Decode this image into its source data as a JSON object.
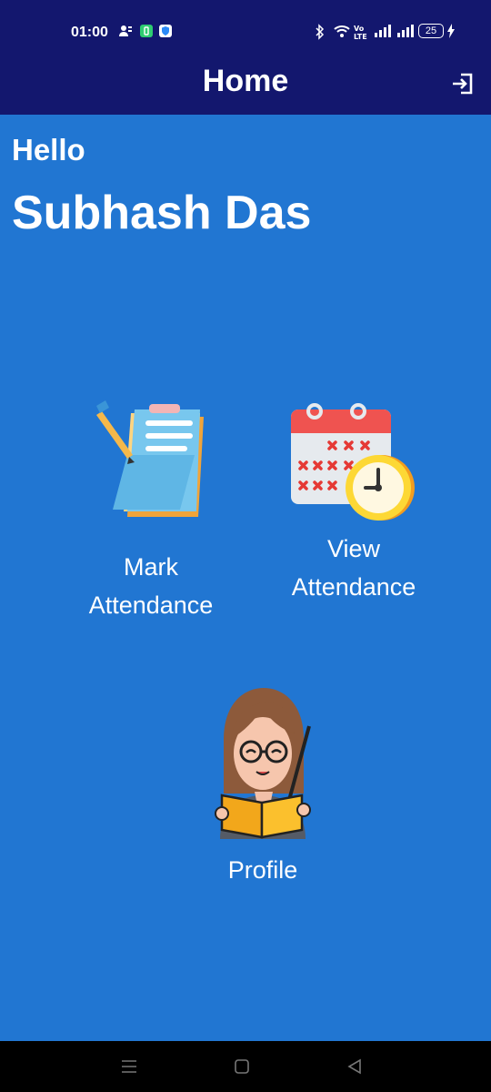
{
  "status_bar": {
    "time": "01:00",
    "icons": [
      "contacts-icon",
      "battery-saver-icon",
      "shield-icon",
      "bluetooth-icon",
      "wifi-icon",
      "volte-icon",
      "signal-icon",
      "signal-2-icon",
      "battery-icon",
      "charging-icon"
    ],
    "volte_label": "VoLTE",
    "battery_level": "25"
  },
  "header": {
    "title": "Home",
    "logout_icon": "logout-icon"
  },
  "greeting": {
    "hello": "Hello",
    "name": "Subhash Das"
  },
  "menu": {
    "mark_attendance": {
      "line1": "Mark",
      "line2": "Attendance",
      "icon": "clipboard-icon"
    },
    "view_attendance": {
      "line1": "View",
      "line2": "Attendance",
      "icon": "calendar-clock-icon"
    },
    "profile": {
      "label": "Profile",
      "icon": "teacher-avatar-icon"
    }
  },
  "nav_bar": {
    "items": [
      "menu-icon",
      "home-icon",
      "back-icon"
    ]
  },
  "colors": {
    "header_bg": "#13176e",
    "page_bg": "#2176d2",
    "nav_bg": "#000000"
  }
}
